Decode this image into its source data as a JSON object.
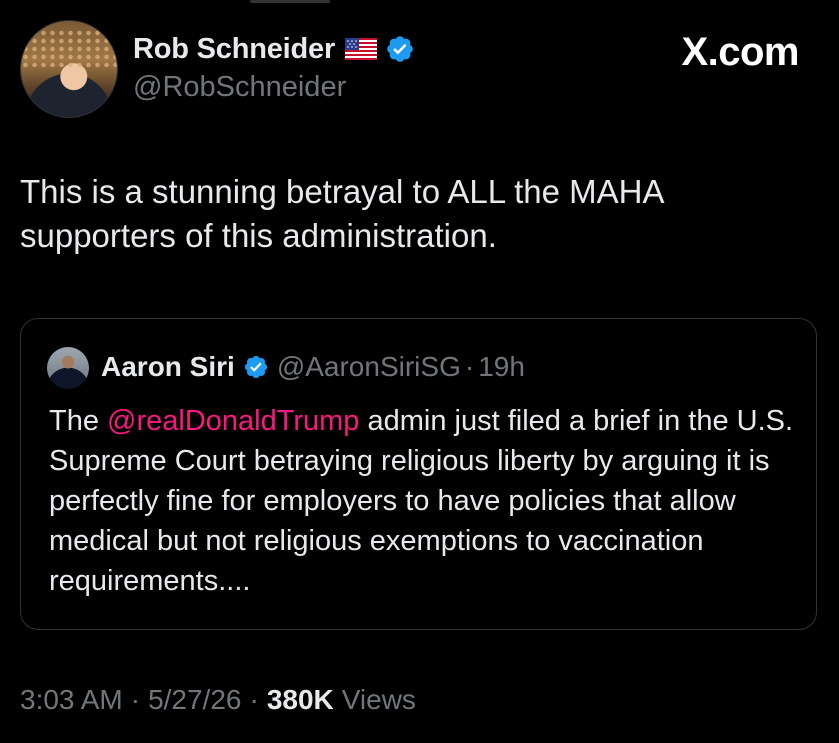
{
  "tweet": {
    "author_name": "Rob Schneider",
    "author_handle": "@RobSchneider",
    "author_flag_icon": "us-flag-icon",
    "author_verified_icon": "verified-badge-icon",
    "text": "This is a stunning betrayal to ALL the MAHA supporters of this administration.",
    "time": "3:03 AM",
    "date": "5/27/26",
    "views_count": "380K",
    "views_label": "Views",
    "separator": "·"
  },
  "brand": {
    "label": "X.com"
  },
  "quote": {
    "author_name": "Aaron Siri",
    "author_handle": "@AaronSiriSG",
    "separator": "·",
    "time_ago": "19h",
    "text_before": "The ",
    "mention": "@realDonaldTrump",
    "text_after": " admin just filed a brief in the U.S. Supreme Court betraying religious liberty by arguing it is perfectly fine for employers to have policies that allow medical but not religious exemptions to vaccination requirements...."
  },
  "colors": {
    "background": "#000000",
    "primary_text": "#e7e9ea",
    "secondary_text": "#71767b",
    "verified_blue": "#1d9bf0",
    "mention_pink": "#f91880",
    "border": "#2f3336"
  }
}
